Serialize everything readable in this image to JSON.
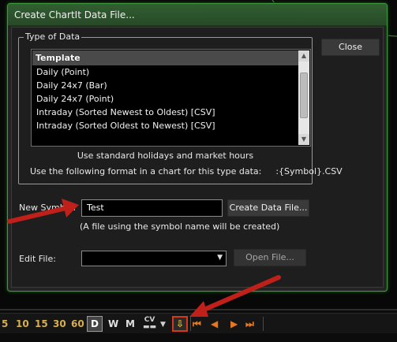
{
  "dialog": {
    "title": "Create ChartIt Data File...",
    "group_label": "Type of Data",
    "list_header": "Template",
    "templates": [
      "Daily (Point)",
      "Daily 24x7 (Bar)",
      "Daily 24x7 (Point)",
      "Intraday (Sorted Newest to Oldest) [CSV]",
      "Intraday (Sorted Oldest to Newest) [CSV]"
    ],
    "holiday_note": "Use standard holidays and market hours",
    "format_label": "Use the following format in a chart for this type data:",
    "format_value": ":{Symbol}.CSV",
    "close_label": "Close",
    "new_symbol_label": "New Symbol:",
    "new_symbol_value": "Test",
    "create_label": "Create Data File...",
    "hint": "(A file using the symbol name will be created)",
    "edit_file_label": "Edit File:",
    "edit_file_value": "",
    "open_label": "Open File..."
  },
  "toolbar": {
    "intervals": [
      "5",
      "10",
      "15",
      "30",
      "60"
    ],
    "daily": "D",
    "weekly": "W",
    "monthly": "M",
    "cv_top": "CV",
    "cv_bottom": "▬▬",
    "dropdown": "▼",
    "fit_icon": "⇩",
    "nav_first": "⏮",
    "nav_prev": "◀",
    "nav_next": "▶",
    "nav_last": "⏭"
  },
  "colors": {
    "dialog_border": "#3f9a3f",
    "title_bar": "#2e592e",
    "highlight_box": "#d23a1e",
    "annotation_arrow": "#c0201a",
    "interval_text": "#d8b04a",
    "nav_icons": "#e8781e"
  }
}
